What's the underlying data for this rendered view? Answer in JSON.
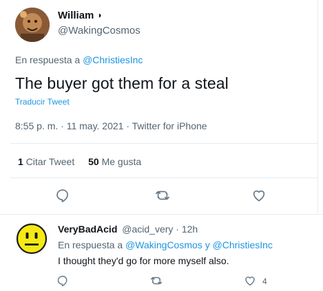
{
  "main_tweet": {
    "author_name": "William",
    "author_badge": "◑",
    "author_handle": "@WakingCosmos",
    "reply_prefix": "En respuesta a",
    "reply_to": "@ChristiesInc",
    "text": "The buyer got them for a steal",
    "translate_label": "Traducir Tweet",
    "timestamp": "8:55 p. m. · 11 may. 2021 · Twitter for iPhone",
    "quote_count": "1",
    "quote_label": "Citar Tweet",
    "like_count": "50",
    "like_label": "Me gusta"
  },
  "reply_tweet": {
    "author_name": "VeryBadAcid",
    "author_handle": "@acid_very · 12h",
    "reply_prefix": "En respuesta a",
    "reply_to_1": "@WakingCosmos",
    "reply_conj": "y",
    "reply_to_2": "@ChristiesInc",
    "text": "I thought they'd go for more myself also.",
    "like_count": "4"
  },
  "colors": {
    "accent": "#1b95e0",
    "secondary_text": "#536471",
    "border": "#e6ecf0",
    "icon": "#657786"
  },
  "icons": [
    "reply-icon",
    "retweet-icon",
    "like-icon"
  ]
}
